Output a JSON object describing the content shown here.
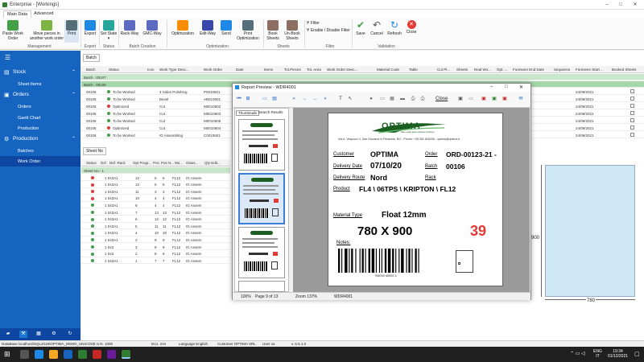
{
  "window": {
    "title": "Enterprise - [Workings]"
  },
  "ribbon": {
    "tabs": [
      "Main Data",
      "Advanced"
    ],
    "buttons": [
      {
        "label": "Paste Work Order",
        "color": "#43a047"
      },
      {
        "label": "Move pieces in another work order",
        "color": "#7cb342"
      },
      {
        "label": "Print",
        "color": "#546e7a"
      },
      {
        "label": "Export",
        "color": "#1e88e5"
      },
      {
        "label": "Set State",
        "color": "#26a69a"
      },
      {
        "label": "Rack-Way",
        "color": "#5c6bc0"
      },
      {
        "label": "GMC-Way",
        "color": "#5c6bc0"
      },
      {
        "label": "Optimization",
        "color": "#fb8c00"
      },
      {
        "label": "Edit-Way",
        "color": "#3949ab"
      },
      {
        "label": "Send",
        "color": "#1e88e5"
      },
      {
        "label": "Print Optimization",
        "color": "#546e7a"
      },
      {
        "label": "Book Sheets",
        "color": "#8d6e63"
      },
      {
        "label": "Un-Book Sheets",
        "color": "#8d6e63"
      },
      {
        "label": "Save",
        "color": "#43a047"
      },
      {
        "label": "Cancel",
        "color": "#e53935"
      },
      {
        "label": "Refresh",
        "color": "#1e88e5"
      },
      {
        "label": "Close",
        "color": "#e53935"
      }
    ],
    "filter_items": [
      "Filter",
      "Enable / Disable Filter"
    ],
    "groups": [
      "Management",
      "Export",
      "Status",
      "Batch Creation",
      "Optimization",
      "Sheets",
      "Filter",
      "Validation"
    ]
  },
  "sidebar": {
    "sections": [
      {
        "label": "Stock",
        "items": [
          "Sheet Items"
        ]
      },
      {
        "label": "Orders",
        "items": [
          "Orders",
          "Gantt Chart",
          "Production"
        ]
      },
      {
        "label": "Production",
        "items": [
          "Batches",
          "Work Order"
        ]
      }
    ]
  },
  "batch_grid": {
    "group_by": "Batch",
    "columns": [
      "Batch",
      "Status",
      "Icon",
      "Work Type Desc...",
      "Work Order",
      "Date",
      "Items",
      "Tot.Pieces",
      "Tot. Area",
      "Work Order Desc...",
      "Material Code",
      "Table",
      "Cut Pl...",
      "Sheets",
      "Real Wo...",
      "Opt. ...",
      "Foreseen End Date",
      "Sequence",
      "Foreseen Start ...",
      "Booked Sheets"
    ],
    "groups": [
      "Batch : 00107",
      "Batch : 00106"
    ],
    "rows": [
      {
        "batch": "00106",
        "status": "To be Worked",
        "status_color": "#43a047",
        "type": "4 Sides Polishing",
        "order": "P0010601",
        "fend": "24/09/2021"
      },
      {
        "batch": "00106",
        "status": "To be Worked",
        "status_color": "#43a047",
        "type": "Bevel",
        "order": "AB010601",
        "fend": "24/09/2021"
      },
      {
        "batch": "00106",
        "status": "Optimized",
        "status_color": "#e53935",
        "type": "Cut",
        "order": "M0010602",
        "fend": "24/09/2021"
      },
      {
        "batch": "00106",
        "status": "To be Worked",
        "status_color": "#43a047",
        "type": "Cut",
        "order": "M0010603",
        "fend": "24/09/2021"
      },
      {
        "batch": "00106",
        "status": "To be Worked",
        "status_color": "#43a047",
        "type": "Cut",
        "order": "M0010605",
        "fend": "24/09/2021"
      },
      {
        "batch": "00106",
        "status": "Optimized",
        "status_color": "#e53935",
        "type": "Cut",
        "order": "M0010604",
        "fend": "24/09/2021"
      },
      {
        "batch": "00106",
        "status": "To be Worked",
        "status_color": "#43a047",
        "type": "IG Assembling",
        "order": "C0010601",
        "fend": "24/09/2021"
      }
    ]
  },
  "sheet_grid": {
    "group_by": "Sheet No",
    "columns": [
      "Status",
      "Dxf",
      "Def. Rack",
      "Opt Progr...",
      "Pos",
      "Pos N...",
      "Mo...",
      "Glass...",
      "Qty Edit..."
    ],
    "group": "Sheet No : 1",
    "rows": [
      {
        "c": "#e53935",
        "rack": "1 043A1",
        "opt": "12",
        "pos": "6",
        "posn": "6",
        "mo": "FL12",
        "glass": "IG Assem"
      },
      {
        "c": "#e53935",
        "rack": "1 043A1",
        "opt": "12",
        "pos": "5",
        "posn": "5",
        "mo": "FL12",
        "glass": "IG Assem"
      },
      {
        "c": "#e53935",
        "rack": "1 043A1",
        "opt": "11",
        "pos": "3",
        "posn": "3",
        "mo": "FL12",
        "glass": "IG Assem"
      },
      {
        "c": "#e53935",
        "rack": "1 043A1",
        "opt": "10",
        "pos": "4",
        "posn": "4",
        "mo": "FL12",
        "glass": "IG Assem"
      },
      {
        "c": "#43a047",
        "rack": "1 043A1",
        "opt": "9",
        "pos": "4",
        "posn": "4",
        "mo": "FL12",
        "glass": "IG Assem"
      },
      {
        "c": "#43a047",
        "rack": "1 043A1",
        "opt": "7",
        "pos": "13",
        "posn": "13",
        "mo": "FL12",
        "glass": "IG Assem"
      },
      {
        "c": "#43a047",
        "rack": "1 043A1",
        "opt": "6",
        "pos": "12",
        "posn": "12",
        "mo": "FL12",
        "glass": "IG Assem"
      },
      {
        "c": "#43a047",
        "rack": "1 043A1",
        "opt": "5",
        "pos": "11",
        "posn": "11",
        "mo": "FL12",
        "glass": "IG Assem"
      },
      {
        "c": "#43a047",
        "rack": "1 043A1",
        "opt": "4",
        "pos": "10",
        "posn": "10",
        "mo": "FL12",
        "glass": "IG Assem"
      },
      {
        "c": "#43a047",
        "rack": "1 043A1",
        "opt": "3",
        "pos": "9",
        "posn": "9",
        "mo": "FL12",
        "glass": "IG Assem"
      },
      {
        "c": "#43a047",
        "rack": "1 043",
        "opt": "3",
        "pos": "9",
        "posn": "9",
        "mo": "FL12",
        "glass": "IG Assem"
      },
      {
        "c": "#43a047",
        "rack": "1 043",
        "opt": "2",
        "pos": "8",
        "posn": "8",
        "mo": "FL12",
        "glass": "IG Assem"
      },
      {
        "c": "#43a047",
        "rack": "1 043A1",
        "opt": "1",
        "pos": "7",
        "posn": "7",
        "mo": "FL12",
        "glass": "IG Assem"
      }
    ]
  },
  "preview": {
    "title": "Report Preview - WDR4001",
    "tabs": [
      "Thumbnails",
      "Search Results"
    ],
    "close_label": "Close",
    "status": {
      "zoom_pct": "100%",
      "page": "Page 9 of 13",
      "zoom": "Zoom 137%",
      "report": "WDR4001"
    },
    "label": {
      "logo": "OPTIMA",
      "logo_sub": "tailor-made glass software solutions",
      "address": "Via A. Vespucci 4, San Giovanni in Persiceto, BO - Phone: +39 051 826336 - optima@optima.it",
      "customer_label": "Customer",
      "customer": "OPTIMA",
      "order_label": "Order",
      "order": "ORD-00123-21 -",
      "delivery_date_label": "Delivery Date",
      "delivery_date": "07/10/20",
      "batch_label": "Batch",
      "batch": "00106",
      "route_label": "Delivery Route",
      "route": "Nord",
      "rack_label": "Rack",
      "product_label": "Product",
      "product": "FL4 \\ 06TPS \\ KRIPTON \\ FL12",
      "material_type_label": "Material Type",
      "material_type": "Float 12mm",
      "dimensions": "780 X 900",
      "position_number": "39",
      "notes_label": "Notes:",
      "barcode_text": "SNOW 40002 4"
    }
  },
  "drawing": {
    "width_label": "780",
    "height_label": "900",
    "fill": "#cfe8f5"
  },
  "statusbar": {
    "db": "DataBase localhost\\SQL2019\\OPTIMA_DEMO_UNICODE S.N. 1000",
    "mu": "M.U. mm",
    "lang": "Language English",
    "customer": "Customer OPTIMA SRL",
    "user": "User sa",
    "version": "v. 6.5.1.0"
  },
  "taskbar": {
    "lang": "ENG",
    "region": "IT",
    "time": "19:34",
    "date": "01/12/2021"
  }
}
